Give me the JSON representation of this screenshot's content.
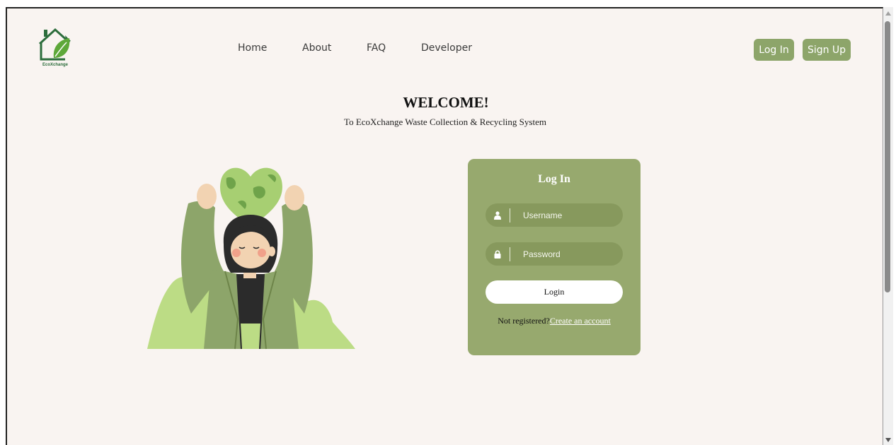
{
  "brand": {
    "logo_text": "EcoXchange"
  },
  "nav": {
    "items": [
      "Home",
      "About",
      "FAQ",
      "Developer"
    ]
  },
  "auth_buttons": {
    "login": "Log In",
    "signup": "Sign Up"
  },
  "hero": {
    "title": "WELCOME!",
    "subtitle": "To EcoXchange Waste Collection & Recycling System"
  },
  "login_form": {
    "title": "Log In",
    "username_placeholder": "Username",
    "password_placeholder": "Password",
    "submit_label": "Login",
    "register_prompt": "Not registered?",
    "register_link": "Create an account"
  },
  "colors": {
    "page_background": "#f9f4f1",
    "accent": "#8da56a",
    "card": "#97a96e",
    "field": "#87995d"
  },
  "icons": {
    "username": "user-icon",
    "password": "lock-icon"
  }
}
